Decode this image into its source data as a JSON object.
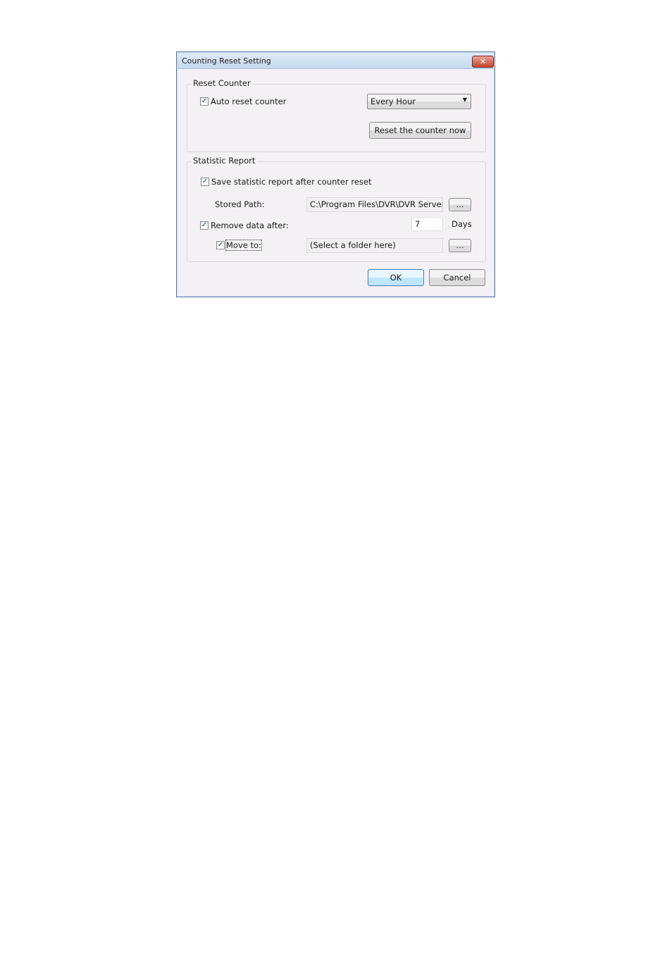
{
  "dialog": {
    "title": "Counting Reset Setting",
    "close_icon": "close-icon"
  },
  "reset_counter": {
    "group_label": "Reset Counter",
    "auto_reset_label": "Auto reset counter",
    "auto_reset_checked": true,
    "interval_selected": "Every Hour",
    "reset_now_label": "Reset the counter now"
  },
  "statistic_report": {
    "group_label": "Statistic Report",
    "save_label": "Save statistic report after counter reset",
    "save_checked": true,
    "stored_path_label": "Stored Path:",
    "stored_path_value": "C:\\Program Files\\DVR\\DVR Server\\",
    "browse_label": "...",
    "remove_label": "Remove data after:",
    "remove_checked": true,
    "days_value": "7",
    "days_unit": "Days",
    "move_label": "Move to:",
    "move_checked": true,
    "move_placeholder": "(Select a folder here)",
    "move_browse_label": "..."
  },
  "buttons": {
    "ok": "OK",
    "cancel": "Cancel"
  }
}
